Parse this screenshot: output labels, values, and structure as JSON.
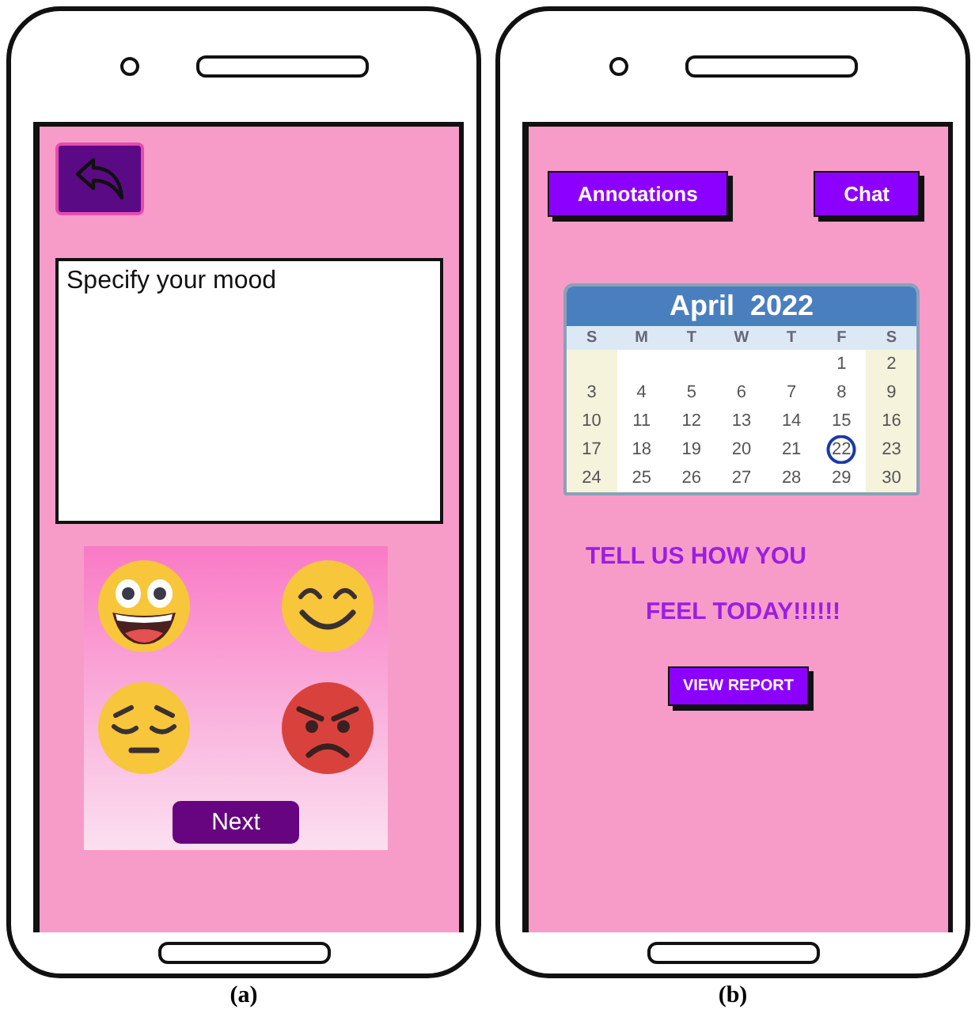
{
  "phones": [
    {
      "kind": "mood",
      "caption": "(a)",
      "prompt": "Specify your mood",
      "moods": [
        {
          "kind": "grinning"
        },
        {
          "kind": "smiling"
        },
        {
          "kind": "pensive"
        },
        {
          "kind": "angry"
        }
      ],
      "next_button": "Next"
    },
    {
      "kind": "calendar",
      "caption": "(b)",
      "buttons": [
        "Annotations",
        "Chat"
      ],
      "calendar": {
        "title": "April  2022",
        "weekdays": [
          "S",
          "M",
          "T",
          "W",
          "T",
          "F",
          "S"
        ],
        "weeks": [
          [
            {
              "day": "1",
              "selected": false
            },
            {
              "day": "2",
              "selected": false
            }
          ],
          [
            {
              "day": "3",
              "selected": false
            },
            {
              "day": "4",
              "selected": false
            },
            {
              "day": "5",
              "selected": false
            },
            {
              "day": "6",
              "selected": false
            },
            {
              "day": "7",
              "selected": false
            },
            {
              "day": "8",
              "selected": false
            },
            {
              "day": "9",
              "selected": false
            }
          ],
          [
            {
              "day": "10",
              "selected": false
            },
            {
              "day": "11",
              "selected": false
            },
            {
              "day": "12",
              "selected": false
            },
            {
              "day": "13",
              "selected": false
            },
            {
              "day": "14",
              "selected": false
            },
            {
              "day": "15",
              "selected": false
            },
            {
              "day": "16",
              "selected": false
            }
          ],
          [
            {
              "day": "17",
              "selected": false
            },
            {
              "day": "18",
              "selected": false
            },
            {
              "day": "19",
              "selected": false
            },
            {
              "day": "20",
              "selected": false
            },
            {
              "day": "21",
              "selected": false
            },
            {
              "day": "22",
              "selected": true
            },
            {
              "day": "23",
              "selected": false
            }
          ],
          [
            {
              "day": "24",
              "selected": false
            },
            {
              "day": "25",
              "selected": false
            },
            {
              "day": "26",
              "selected": false
            },
            {
              "day": "27",
              "selected": false
            },
            {
              "day": "28",
              "selected": false
            },
            {
              "day": "29",
              "selected": false
            },
            {
              "day": "30",
              "selected": false
            }
          ]
        ]
      },
      "message_lines": [
        "TELL US HOW YOU",
        "FEEL TODAY!!!!!!"
      ],
      "report_button": "VIEW REPORT"
    }
  ]
}
